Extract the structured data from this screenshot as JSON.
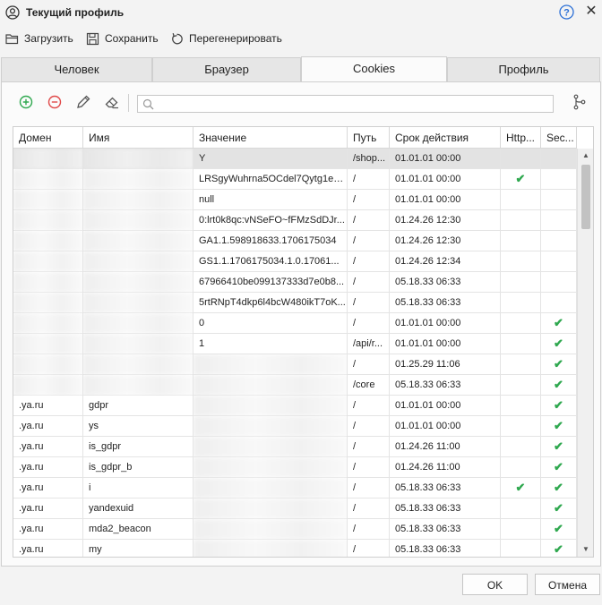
{
  "window": {
    "title": "Текущий профиль",
    "help_icon": "question-circle-icon",
    "close_glyph": "✕"
  },
  "toolbar": {
    "load_label": "Загрузить",
    "save_label": "Сохранить",
    "regenerate_label": "Перегенерировать"
  },
  "tabs": [
    {
      "label": "Человек"
    },
    {
      "label": "Браузер"
    },
    {
      "label": "Cookies",
      "active": true
    },
    {
      "label": "Профиль"
    }
  ],
  "panel": {
    "search_placeholder": "",
    "search_value": ""
  },
  "colors": {
    "check": "#2fa84f",
    "add": "#2fa84f",
    "remove": "#e04848"
  },
  "grid": {
    "columns": [
      "Домен",
      "Имя",
      "Значение",
      "Путь",
      "Срок действия",
      "Http...",
      "Sec..."
    ],
    "rows": [
      {
        "domain": "",
        "name": "",
        "value": "Y",
        "path": "/shop...",
        "expires": "01.01.01 00:00",
        "http": false,
        "secure": false,
        "blur_dn": true,
        "blur_value": false,
        "selected": true
      },
      {
        "domain": "",
        "name": "",
        "value": "LRSgyWuhrna5OCdel7Qytg1ee...",
        "path": "/",
        "expires": "01.01.01 00:00",
        "http": true,
        "secure": false,
        "blur_dn": true,
        "blur_value": false
      },
      {
        "domain": "",
        "name": "",
        "value": "null",
        "path": "/",
        "expires": "01.01.01 00:00",
        "http": false,
        "secure": false,
        "blur_dn": true,
        "blur_value": false
      },
      {
        "domain": "",
        "name": "",
        "value": "0:lrt0k8qc:vNSeFO~fFMzSdDJr...",
        "path": "/",
        "expires": "01.24.26 12:30",
        "http": false,
        "secure": false,
        "blur_dn": true,
        "blur_value": false
      },
      {
        "domain": "",
        "name": "",
        "value": "GA1.1.598918633.1706175034",
        "path": "/",
        "expires": "01.24.26 12:30",
        "http": false,
        "secure": false,
        "blur_dn": true,
        "blur_value": false
      },
      {
        "domain": "",
        "name": "",
        "value": "GS1.1.1706175034.1.0.17061...",
        "path": "/",
        "expires": "01.24.26 12:34",
        "http": false,
        "secure": false,
        "blur_dn": true,
        "blur_value": false
      },
      {
        "domain": "",
        "name": "",
        "value": "67966410be099137333d7e0b8...",
        "path": "/",
        "expires": "05.18.33 06:33",
        "http": false,
        "secure": false,
        "blur_dn": true,
        "blur_value": false
      },
      {
        "domain": "",
        "name": "",
        "value": "5rtRNpT4dkp6l4bcW480ikT7oK...",
        "path": "/",
        "expires": "05.18.33 06:33",
        "http": false,
        "secure": false,
        "blur_dn": true,
        "blur_value": false
      },
      {
        "domain": "",
        "name": "",
        "value": "0",
        "path": "/",
        "expires": "01.01.01 00:00",
        "http": false,
        "secure": true,
        "blur_dn": true,
        "blur_value": false
      },
      {
        "domain": "",
        "name": "",
        "value": "1",
        "path": "/api/r...",
        "expires": "01.01.01 00:00",
        "http": false,
        "secure": true,
        "blur_dn": true,
        "blur_value": false
      },
      {
        "domain": "",
        "name": "",
        "value": "",
        "path": "/",
        "expires": "01.25.29 11:06",
        "http": false,
        "secure": true,
        "blur_dn": true,
        "blur_value": true
      },
      {
        "domain": "",
        "name": "",
        "value": "",
        "path": "/core",
        "expires": "05.18.33 06:33",
        "http": false,
        "secure": true,
        "blur_dn": true,
        "blur_value": true
      },
      {
        "domain": ".ya.ru",
        "name": "gdpr",
        "value": "",
        "path": "/",
        "expires": "01.01.01 00:00",
        "http": false,
        "secure": true,
        "blur_dn": false,
        "blur_value": true
      },
      {
        "domain": ".ya.ru",
        "name": "ys",
        "value": "",
        "path": "/",
        "expires": "01.01.01 00:00",
        "http": false,
        "secure": true,
        "blur_dn": false,
        "blur_value": true
      },
      {
        "domain": ".ya.ru",
        "name": "is_gdpr",
        "value": "",
        "path": "/",
        "expires": "01.24.26 11:00",
        "http": false,
        "secure": true,
        "blur_dn": false,
        "blur_value": true
      },
      {
        "domain": ".ya.ru",
        "name": "is_gdpr_b",
        "value": "",
        "path": "/",
        "expires": "01.24.26 11:00",
        "http": false,
        "secure": true,
        "blur_dn": false,
        "blur_value": true
      },
      {
        "domain": ".ya.ru",
        "name": "i",
        "value": "",
        "path": "/",
        "expires": "05.18.33 06:33",
        "http": true,
        "secure": true,
        "blur_dn": false,
        "blur_value": true
      },
      {
        "domain": ".ya.ru",
        "name": "yandexuid",
        "value": "",
        "path": "/",
        "expires": "05.18.33 06:33",
        "http": false,
        "secure": true,
        "blur_dn": false,
        "blur_value": true
      },
      {
        "domain": ".ya.ru",
        "name": "mda2_beacon",
        "value": "",
        "path": "/",
        "expires": "05.18.33 06:33",
        "http": false,
        "secure": true,
        "blur_dn": false,
        "blur_value": true
      },
      {
        "domain": ".ya.ru",
        "name": "my",
        "value": "",
        "path": "/",
        "expires": "05.18.33 06:33",
        "http": false,
        "secure": true,
        "blur_dn": false,
        "blur_value": true
      }
    ]
  },
  "footer": {
    "ok_label": "OK",
    "cancel_label": "Отмена"
  }
}
